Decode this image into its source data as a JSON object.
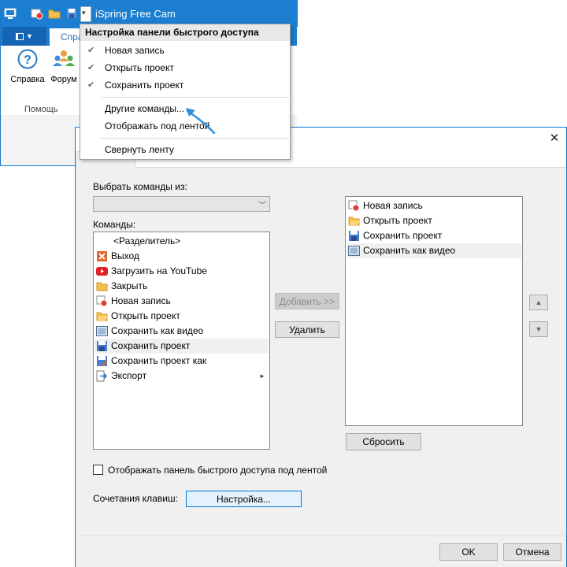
{
  "app": {
    "title": "iSpring Free Cam",
    "file_tab_icon": "file-menu-icon",
    "tab_label": "Спра",
    "ribbon_buttons": [
      {
        "label": "Справка",
        "icon": "help-icon"
      },
      {
        "label": "Форум",
        "icon": "forum-icon"
      }
    ],
    "group_label": "Помощь"
  },
  "qa_menu": {
    "header": "Настройка панели быстрого доступа",
    "checked_items": [
      "Новая запись",
      "Открыть проект",
      "Сохранить проект"
    ],
    "items": [
      "Другие команды...",
      "Отображать под лентой"
    ],
    "last_item": "Свернуть ленту"
  },
  "dialog": {
    "choose_from_label": "Выбрать команды из:",
    "choose_from_value": "",
    "commands_label": "Команды:",
    "commands": [
      {
        "label": "<Разделитель>",
        "icon": ""
      },
      {
        "label": "Выход",
        "icon": "exit-icon"
      },
      {
        "label": "Загрузить на YouTube",
        "icon": "youtube-icon"
      },
      {
        "label": "Закрыть",
        "icon": "folder-icon"
      },
      {
        "label": "Новая запись",
        "icon": "record-icon"
      },
      {
        "label": "Открыть проект",
        "icon": "open-folder-icon"
      },
      {
        "label": "Сохранить как видео",
        "icon": "film-icon"
      },
      {
        "label": "Сохранить проект",
        "icon": "save-icon"
      },
      {
        "label": "Сохранить проект как",
        "icon": "save-as-icon"
      },
      {
        "label": "Экспорт",
        "icon": "export-icon"
      }
    ],
    "selected_command_index": 7,
    "add_button": "Добавить >>",
    "remove_button": "Удалить",
    "quick_access_items": [
      {
        "label": "Новая запись",
        "icon": "record-icon"
      },
      {
        "label": "Открыть проект",
        "icon": "open-folder-icon"
      },
      {
        "label": "Сохранить проект",
        "icon": "save-icon"
      },
      {
        "label": "Сохранить как видео",
        "icon": "film-icon"
      }
    ],
    "selected_quick_index": 3,
    "reset_button": "Сбросить",
    "show_below_ribbon_label": "Отображать панель быстрого доступа под лентой",
    "show_below_ribbon_checked": false,
    "shortcuts_label": "Сочетания клавиш:",
    "shortcuts_button": "Настройка...",
    "ok_button": "OK",
    "cancel_button": "Отмена"
  },
  "colors": {
    "titlebar": "#1b7ed0",
    "accent": "#0078d7"
  }
}
